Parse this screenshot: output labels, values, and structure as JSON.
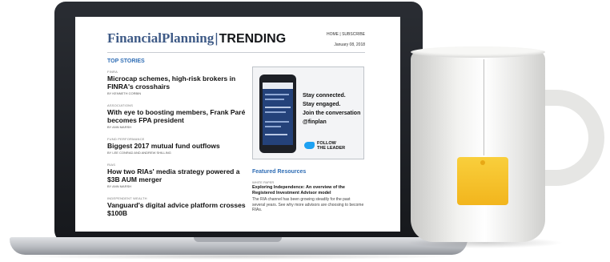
{
  "header": {
    "brand": "FinancialPlanning",
    "separator": "|",
    "sub": "TRENDING",
    "links": "HOME  |  SUBSCRIBE",
    "date": "January 08, 2018"
  },
  "top_stories": {
    "title": "TOP STORIES",
    "items": [
      {
        "category": "FINRA",
        "title": "Microcap schemes, high-risk brokers in FINRA's crosshairs",
        "byline": "by KENNETH CORBIN"
      },
      {
        "category": "ASSOCIATIONS",
        "title": "With eye to boosting members, Frank Paré becomes FPA president",
        "byline": "by ANN MARSH"
      },
      {
        "category": "FUND PERFORMANCE",
        "title": "Biggest 2017 mutual fund outflows",
        "byline": "by LEE CONRAD AND ANDREW SHILLING"
      },
      {
        "category": "RIAs",
        "title": "How two RIAs' media strategy powered a $3B AUM merger",
        "byline": "by ANN MARSH"
      },
      {
        "category": "INDEPENDENT WEALTH",
        "title": "Vanguard's digital advice platform crosses $100B",
        "byline": ""
      }
    ]
  },
  "promo": {
    "phone_title": "FinancialPlanning",
    "lines": [
      "Stay connected.",
      "Stay engaged.",
      "Join the conversation",
      "@finplan"
    ],
    "follow": [
      "FOLLOW",
      "THE LEADER"
    ]
  },
  "featured": {
    "title": "Featured Resources",
    "category": "WHITE PAPER",
    "item_title": "Exploring Independence: An overview of the Registered Investment Advisor model",
    "description": "The RIA channel has been growing steadily for the past several years. See why more advisors are choosing to become RIAs."
  },
  "colors": {
    "brand": "#3e5a86",
    "section": "#2f6db5",
    "tea_tag": "#f2b51d",
    "twitter": "#1da1f2"
  }
}
